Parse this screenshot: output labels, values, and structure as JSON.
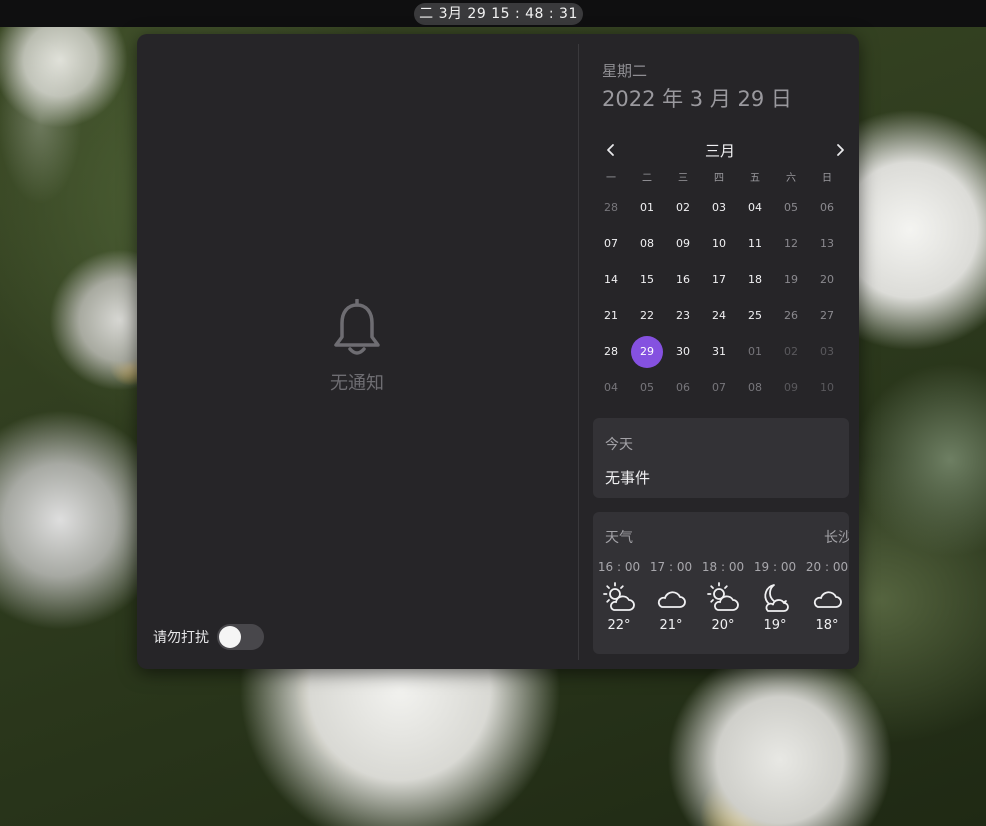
{
  "topbar": {
    "clock": "二 3月 29  15 : 48 : 31"
  },
  "notifications": {
    "empty_label": "无通知",
    "dnd_label": "请勿打扰",
    "dnd_enabled": false
  },
  "calendar": {
    "weekday": "星期二",
    "full_date": "2022 年 3 月 29 日",
    "month_title": "三月",
    "prev_icon": "chevron-left-icon",
    "next_icon": "chevron-right-icon",
    "dow": [
      "一",
      "二",
      "三",
      "四",
      "五",
      "六",
      "日"
    ],
    "weeks": [
      [
        "28",
        "01",
        "02",
        "03",
        "04",
        "05",
        "06"
      ],
      [
        "07",
        "08",
        "09",
        "10",
        "11",
        "12",
        "13"
      ],
      [
        "14",
        "15",
        "16",
        "17",
        "18",
        "19",
        "20"
      ],
      [
        "21",
        "22",
        "23",
        "24",
        "25",
        "26",
        "27"
      ],
      [
        "28",
        "29",
        "30",
        "31",
        "01",
        "02",
        "03"
      ],
      [
        "04",
        "05",
        "06",
        "07",
        "08",
        "09",
        "10"
      ]
    ],
    "today": "29",
    "accent_color": "#8551e0"
  },
  "events": {
    "title": "今天",
    "body": "无事件"
  },
  "weather": {
    "title": "天气",
    "city": "长沙",
    "forecast": [
      {
        "time": "16 : 00",
        "icon": "sun-behind-cloud-icon",
        "temp": "22°"
      },
      {
        "time": "17 : 00",
        "icon": "cloud-icon",
        "temp": "21°"
      },
      {
        "time": "18 : 00",
        "icon": "sun-behind-cloud-icon",
        "temp": "20°"
      },
      {
        "time": "19 : 00",
        "icon": "moon-behind-cloud-icon",
        "temp": "19°"
      },
      {
        "time": "20 : 00",
        "icon": "cloud-icon",
        "temp": "18°"
      }
    ]
  }
}
